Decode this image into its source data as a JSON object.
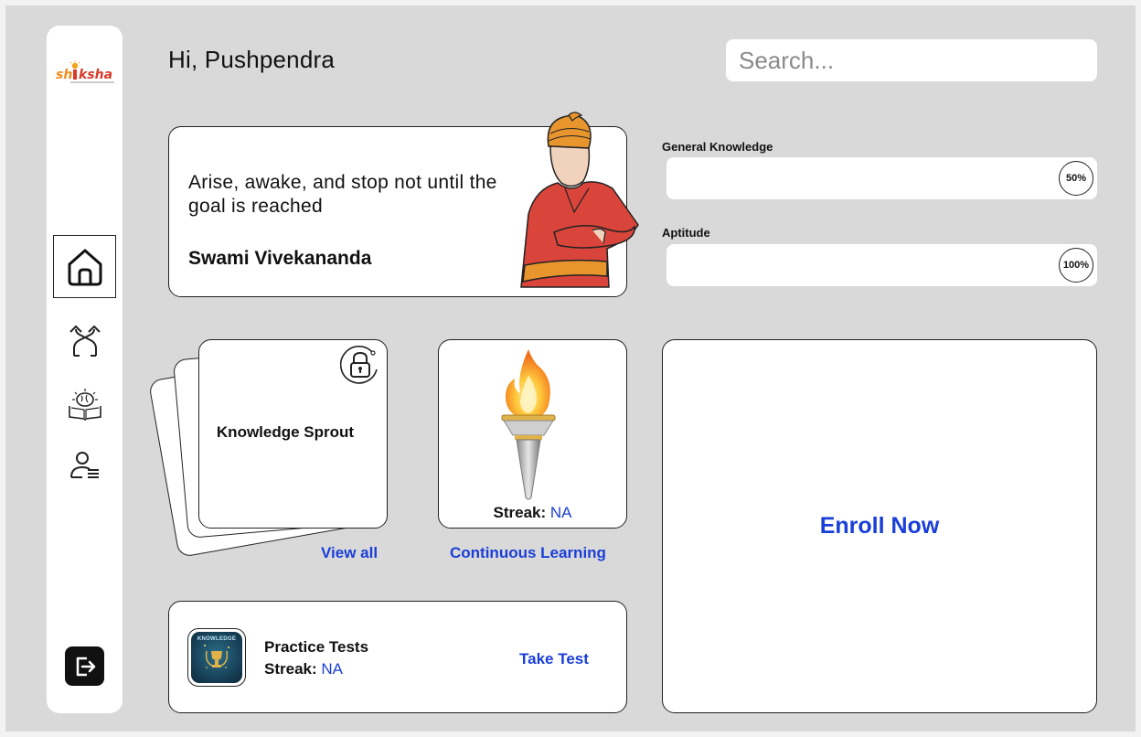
{
  "app": {
    "logo_text": "Shiksha",
    "logo_subtext": "EDUCATION"
  },
  "sidebar": {
    "items": [
      {
        "name": "home",
        "icon": "home-icon",
        "active": true
      },
      {
        "name": "paths",
        "icon": "crossroads-arrows-icon",
        "active": false
      },
      {
        "name": "learning",
        "icon": "brain-book-icon",
        "active": false
      },
      {
        "name": "profile",
        "icon": "user-list-icon",
        "active": false
      }
    ],
    "logout_icon": "logout-icon"
  },
  "header": {
    "greeting": "Hi, Pushpendra",
    "search_placeholder": "Search..."
  },
  "quote": {
    "text": "Arise, awake, and stop not until the goal is reached",
    "author": "Swami Vivekananda"
  },
  "progress": [
    {
      "label": "General Knowledge",
      "value_text": "50%",
      "value": 0.5
    },
    {
      "label": "Aptitude",
      "value_text": "100%",
      "value": 1.0
    }
  ],
  "knowledge_sprout": {
    "title": "Knowledge Sprout",
    "locked": true,
    "link": "View all"
  },
  "streak": {
    "label": "Streak:",
    "value": "NA",
    "link": "Continuous Learning"
  },
  "enroll": {
    "label": "Enroll Now"
  },
  "practice": {
    "thumb_text": "KNOWLEDGE",
    "title": "Practice Tests",
    "streak_label": "Streak:",
    "streak_value": "NA",
    "action": "Take Test"
  },
  "colors": {
    "accent": "#1a3ed8",
    "background": "#d9d9d9",
    "card": "#ffffff"
  }
}
